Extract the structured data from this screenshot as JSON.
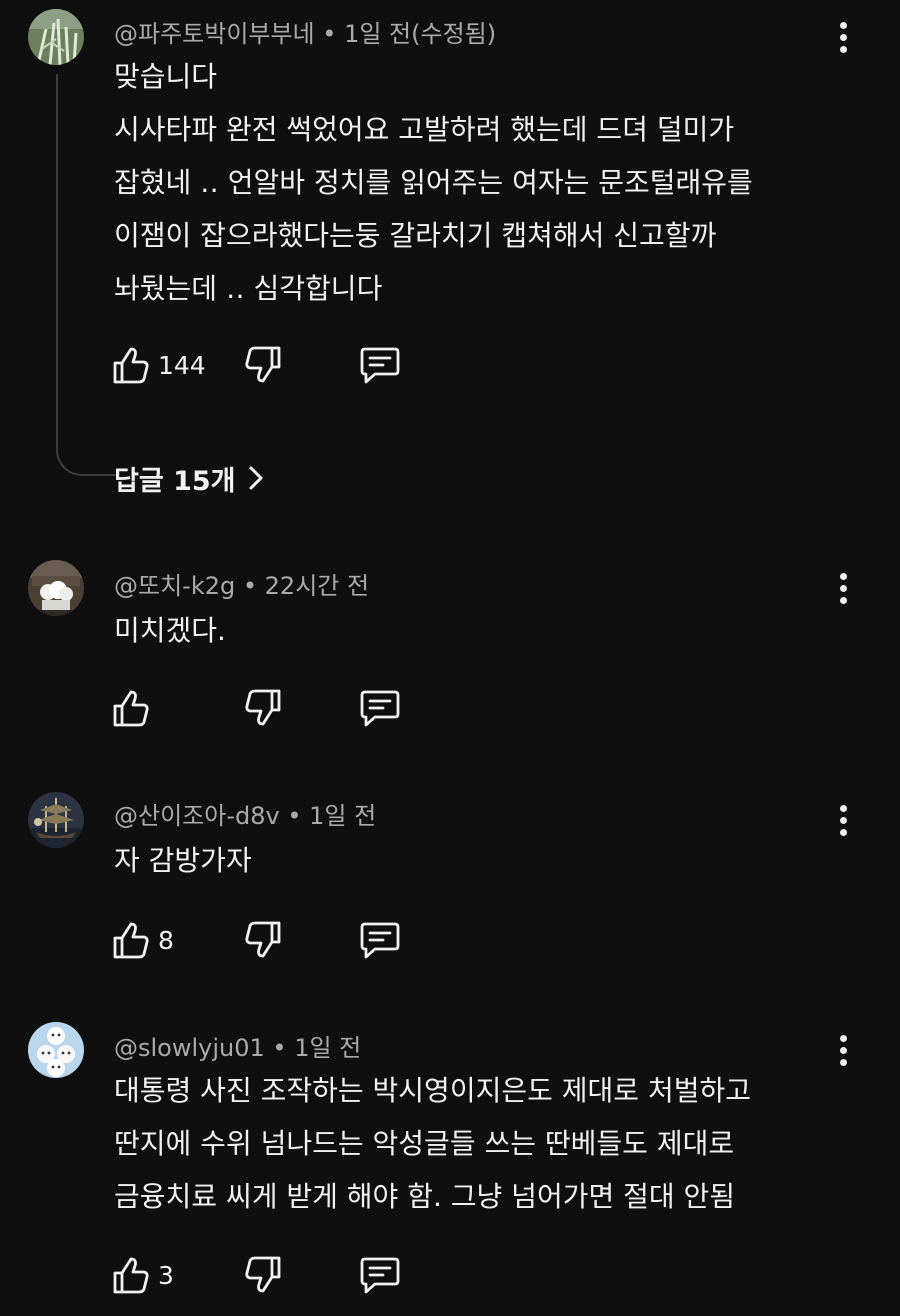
{
  "colors": {
    "background": "#0f0f0f",
    "text": "#f1f1f1",
    "meta": "#aaaaaa"
  },
  "comments": [
    {
      "author": "@파주토박이부부네",
      "time": "1일 전(수정됨)",
      "lines": [
        "맞습니다",
        "시사타파 완전 썩었어요 고발하려 했는데 드뎌 덜미가",
        "잡혔네 ‥ 언알바 정치를 읽어주는 여자는 문조털래유를",
        "이잼이 잡으라했다는둥 갈라치기 캡쳐해서 신고할까",
        "놔뒀는데  ‥ 심각합니다"
      ],
      "likes": "144",
      "replies_label": "답글 15개"
    },
    {
      "author": "@또치-k2g",
      "time": "22시간 전",
      "lines": [
        "미치겠다."
      ],
      "likes": ""
    },
    {
      "author": "@산이조아-d8v",
      "time": "1일 전",
      "lines": [
        "자 감방가자"
      ],
      "likes": "8"
    },
    {
      "author": "@slowlyju01",
      "time": "1일 전",
      "lines": [
        "대통령 사진 조작하는 박시영이지은도 제대로 처벌하고",
        "딴지에 수위 넘나드는 악성글들 쓰는 딴베들도 제대로",
        "금융치료 씨게 받게 해야 함. 그냥 넘어가면 절대 안됨"
      ],
      "likes": "3"
    }
  ],
  "icons": {
    "like": "thumbs-up-icon",
    "dislike": "thumbs-down-icon",
    "reply": "comment-icon",
    "more": "more-vert-icon",
    "chevron": "chevron-right-icon"
  }
}
